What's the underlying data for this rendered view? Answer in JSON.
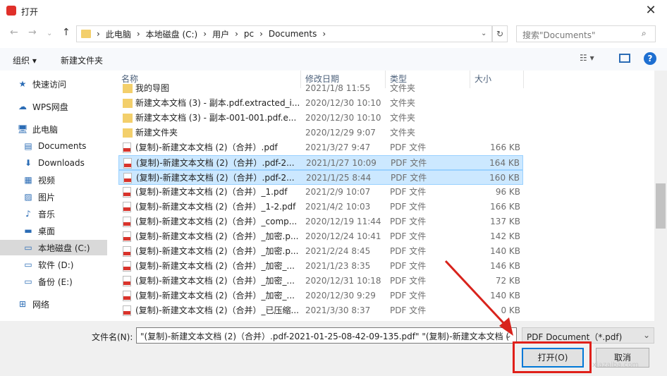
{
  "window": {
    "title": "打开",
    "close": "✕"
  },
  "address": {
    "crumbs": [
      "此电脑",
      "本地磁盘 (C:)",
      "用户",
      "pc",
      "Documents"
    ],
    "search_placeholder": "搜索\"Documents\""
  },
  "toolbar": {
    "organize": "组织 ▾",
    "new_folder": "新建文件夹"
  },
  "sidebar": [
    {
      "label": "快速访问",
      "icon": "★"
    },
    {
      "label": "WPS网盘",
      "icon": "☁"
    },
    {
      "label": "此电脑",
      "icon": "🖥"
    },
    {
      "label": "Documents",
      "icon": "▤"
    },
    {
      "label": "Downloads",
      "icon": "⬇"
    },
    {
      "label": "视频",
      "icon": "▦"
    },
    {
      "label": "图片",
      "icon": "▨"
    },
    {
      "label": "音乐",
      "icon": "♪"
    },
    {
      "label": "桌面",
      "icon": "▬"
    },
    {
      "label": "本地磁盘 (C:)",
      "icon": "▭"
    },
    {
      "label": "软件 (D:)",
      "icon": "▭"
    },
    {
      "label": "备份 (E:)",
      "icon": "▭"
    },
    {
      "label": "网络",
      "icon": "⊞"
    }
  ],
  "columns": [
    "名称",
    "修改日期",
    "类型",
    "大小"
  ],
  "files": [
    {
      "name": "我的导图",
      "date": "2021/1/8 11:55",
      "type": "文件夹",
      "size": "",
      "kind": "folder"
    },
    {
      "name": "新建文本文档 (3) - 副本.pdf.extracted_i...",
      "date": "2020/12/30 10:10",
      "type": "文件夹",
      "size": "",
      "kind": "folder"
    },
    {
      "name": "新建文本文档 (3) - 副本-001-001.pdf.e...",
      "date": "2020/12/30 10:10",
      "type": "文件夹",
      "size": "",
      "kind": "folder"
    },
    {
      "name": "新建文件夹",
      "date": "2020/12/29 9:07",
      "type": "文件夹",
      "size": "",
      "kind": "folder"
    },
    {
      "name": "(复制)-新建文本文档 (2)（合并）.pdf",
      "date": "2021/3/27 9:47",
      "type": "PDF 文件",
      "size": "166 KB",
      "kind": "pdf"
    },
    {
      "name": "(复制)-新建文本文档 (2)（合并）.pdf-2...",
      "date": "2021/1/27 10:09",
      "type": "PDF 文件",
      "size": "164 KB",
      "kind": "pdf",
      "selected": true
    },
    {
      "name": "(复制)-新建文本文档 (2)（合并）.pdf-2...",
      "date": "2021/1/25 8:44",
      "type": "PDF 文件",
      "size": "160 KB",
      "kind": "pdf",
      "selected": true
    },
    {
      "name": "(复制)-新建文本文档 (2)（合并）_1.pdf",
      "date": "2021/2/9 10:07",
      "type": "PDF 文件",
      "size": "96 KB",
      "kind": "pdf"
    },
    {
      "name": "(复制)-新建文本文档 (2)（合并）_1-2.pdf",
      "date": "2021/4/2 10:03",
      "type": "PDF 文件",
      "size": "166 KB",
      "kind": "pdf"
    },
    {
      "name": "(复制)-新建文本文档 (2)（合并）_comp...",
      "date": "2020/12/19 11:44",
      "type": "PDF 文件",
      "size": "137 KB",
      "kind": "pdf"
    },
    {
      "name": "(复制)-新建文本文档 (2)（合并）_加密.p...",
      "date": "2020/12/24 10:41",
      "type": "PDF 文件",
      "size": "142 KB",
      "kind": "pdf"
    },
    {
      "name": "(复制)-新建文本文档 (2)（合并）_加密.p...",
      "date": "2021/2/24 8:45",
      "type": "PDF 文件",
      "size": "140 KB",
      "kind": "pdf"
    },
    {
      "name": "(复制)-新建文本文档 (2)（合并）_加密_...",
      "date": "2021/1/23 8:35",
      "type": "PDF 文件",
      "size": "146 KB",
      "kind": "pdf"
    },
    {
      "name": "(复制)-新建文本文档 (2)（合并）_加密_...",
      "date": "2020/12/31 10:18",
      "type": "PDF 文件",
      "size": "72 KB",
      "kind": "pdf"
    },
    {
      "name": "(复制)-新建文本文档 (2)（合并）_加密_...",
      "date": "2020/12/30 9:29",
      "type": "PDF 文件",
      "size": "140 KB",
      "kind": "pdf"
    },
    {
      "name": "(复制)-新建文本文档 (2)（合并）_已压缩...",
      "date": "2021/3/30 8:37",
      "type": "PDF 文件",
      "size": "0 KB",
      "kind": "pdf"
    }
  ],
  "footer": {
    "filename_label": "文件名(N):",
    "filename_value": "\"(复制)-新建文本文档 (2)（合并）.pdf-2021-01-25-08-42-09-135.pdf\" \"(复制)-新建文本文档 (",
    "filter": "PDF Document（*.pdf)",
    "open": "打开(O)",
    "cancel": "取消"
  },
  "watermark": "xiazaiba.com"
}
